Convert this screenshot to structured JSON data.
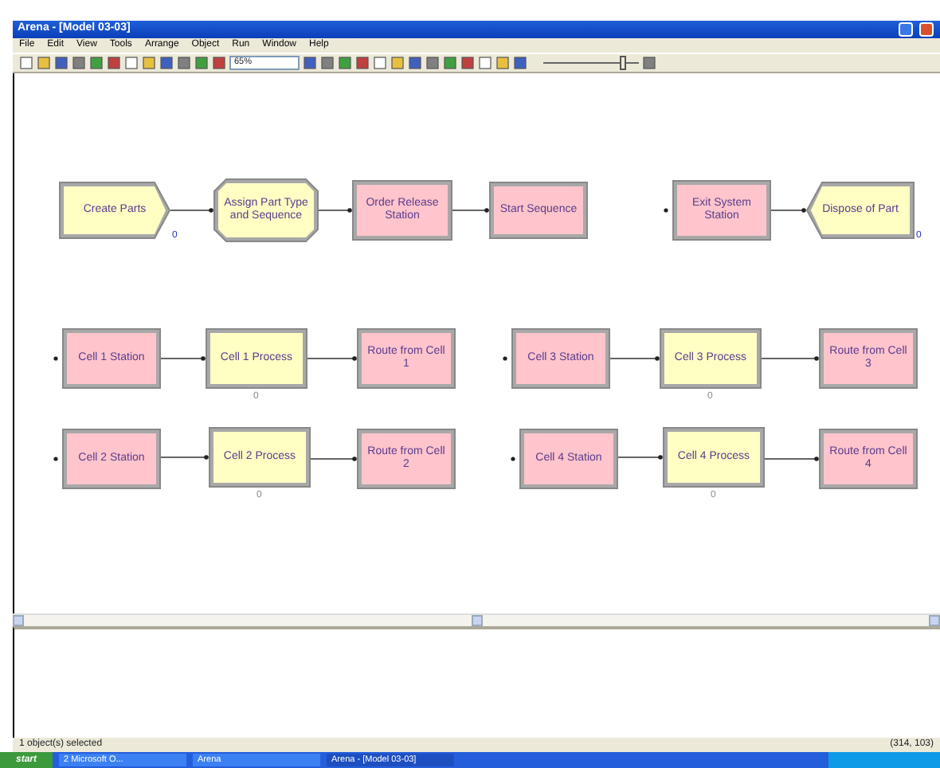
{
  "window": {
    "title": "Arena - [Model 03-03]"
  },
  "menu": [
    "File",
    "Edit",
    "View",
    "Tools",
    "Arrange",
    "Object",
    "Run",
    "Window",
    "Help"
  ],
  "toolbar": {
    "zoom": "65%",
    "speed_slider": {
      "level": 0.85
    }
  },
  "canvas": {
    "rows": [
      {
        "chains": [
          [
            {
              "kind": "create",
              "text": "Create Parts",
              "counter": "0"
            },
            {
              "kind": "assign",
              "text": "Assign Part Type and Sequence"
            },
            {
              "kind": "station",
              "text": "Order Release Station"
            },
            {
              "kind": "sequence",
              "text": "Start Sequence"
            }
          ],
          [
            {
              "kind": "station",
              "text": "Exit System Station"
            },
            {
              "kind": "dispose",
              "text": "Dispose of Part",
              "counter": "0"
            }
          ]
        ]
      },
      {
        "chains": [
          [
            {
              "kind": "station",
              "text": "Cell 1 Station"
            },
            {
              "kind": "process",
              "text": "Cell 1 Process",
              "counter": "0"
            },
            {
              "kind": "route",
              "text": "Route from Cell 1"
            }
          ],
          [
            {
              "kind": "station",
              "text": "Cell 3 Station"
            },
            {
              "kind": "process",
              "text": "Cell 3 Process",
              "counter": "0"
            },
            {
              "kind": "route",
              "text": "Route from Cell 3"
            }
          ]
        ]
      },
      {
        "chains": [
          [
            {
              "kind": "station",
              "text": "Cell 2 Station"
            },
            {
              "kind": "process",
              "text": "Cell 2 Process",
              "counter": "0"
            },
            {
              "kind": "route",
              "text": "Route from Cell 2"
            }
          ],
          [
            {
              "kind": "station",
              "text": "Cell 4 Station"
            },
            {
              "kind": "process",
              "text": "Cell 4 Process",
              "counter": "0"
            },
            {
              "kind": "route",
              "text": "Route from Cell 4"
            }
          ]
        ]
      }
    ]
  },
  "status_bar": {
    "message": "1 object(s) selected",
    "coordinates": "(314, 103)"
  },
  "taskbar": {
    "start": "start",
    "tasks": [
      {
        "label": "2 Microsoft O...",
        "selected": false
      },
      {
        "label": "Arena",
        "selected": false
      },
      {
        "label": "Arena - [Model 03-03]",
        "selected": true
      }
    ]
  }
}
